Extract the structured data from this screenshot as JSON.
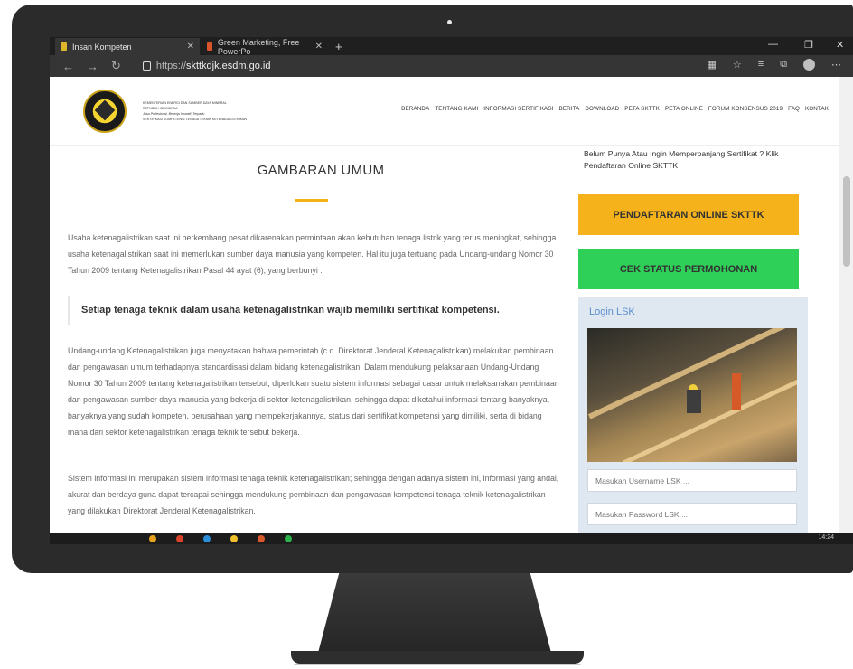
{
  "browser": {
    "tabs": [
      {
        "label": "Insan Kompeten",
        "active": true
      },
      {
        "label": "Green Marketing, Free PowerPo",
        "active": false
      }
    ],
    "url_protocol": "https://",
    "url_host": "skttkdjk.esdm.go.id"
  },
  "header": {
    "org_lines": [
      "KEMENTERIAN ENERGI DAN SUMBER DAYA MINERAL",
      "REPUBLIK INDONESIA",
      "Jasa Profesional, Bekerja Inovatif, Terpadu",
      "SERTIFIKASI KOMPETENSI TENAGA TEKNIK KETENAGALISTRIKAN"
    ],
    "menu": [
      "BERANDA",
      "TENTANG KAMI",
      "INFORMASI SERTIFIKASI",
      "BERITA",
      "DOWNLOAD",
      "PETA SKTTK",
      "PETA ONLINE",
      "FORUM KONSENSUS 2019",
      "FAQ",
      "KONTAK"
    ]
  },
  "main": {
    "title": "GAMBARAN UMUM",
    "para1": "Usaha ketenagalistrikan saat ini berkembang pesat dikarenakan permintaan akan kebutuhan tenaga listrik yang terus meningkat, sehingga usaha ketenagalistrikan saat ini memerlukan sumber daya manusia yang kompeten. Hal itu juga tertuang pada Undang-undang Nomor 30 Tahun 2009 tentang Ketenagalistrikan Pasal 44 ayat (6), yang berbunyi :",
    "quote": "Setiap tenaga teknik dalam usaha ketenagalistrikan wajib memiliki sertifikat kompetensi.",
    "para2": "Undang-undang Ketenagalistrikan juga menyatakan bahwa pemerintah (c.q. Direktorat Jenderal Ketenagalistrikan) melakukan pembinaan dan pengawasan umum terhadapnya standardisasi dalam bidang ketenagalistrikan. Dalam mendukung pelaksanaan Undang-Undang Nomor 30 Tahun 2009 tentang ketenagalistrikan tersebut, diperlukan suatu sistem informasi sebagai dasar untuk melaksanakan pembinaan dan pengawasan sumber daya manusia yang bekerja di sektor ketenagalistrikan, sehingga dapat diketahui informasi tentang banyaknya, banyaknya yang sudah kompeten, perusahaan yang mempekerjakannya, status dari sertifikat kompetensi yang dimiliki, serta di bidang mana dari sektor ketenagalistrikan tenaga teknik tersebut bekerja.",
    "para3": "Sistem informasi ini merupakan sistem informasi tenaga teknik ketenagalistrikan; sehingga dengan adanya sistem ini, informasi yang andal, akurat dan berdaya guna dapat tercapai sehingga mendukung pembinaan dan pengawasan kompetensi tenaga teknik ketenagalistrikan yang dilakukan Direktorat Jenderal Ketenagalistrikan."
  },
  "sidebar": {
    "cta_text": "Belum Punya Atau Ingin Memperpanjang Sertifikat ? Klik Pendaftaran Online SKTTK",
    "btn_register": "PENDAFTARAN ONLINE SKTTK",
    "btn_status": "CEK STATUS PERMOHONAN",
    "login_title": "Login LSK",
    "username_placeholder": "Masukan Username LSK ...",
    "password_placeholder": "Masukan Password LSK ..."
  },
  "taskbar": {
    "clock": "14:24"
  },
  "colors": {
    "accent_yellow": "#f5b21b",
    "accent_green": "#2ed058",
    "login_blue": "#5a8fd0"
  }
}
